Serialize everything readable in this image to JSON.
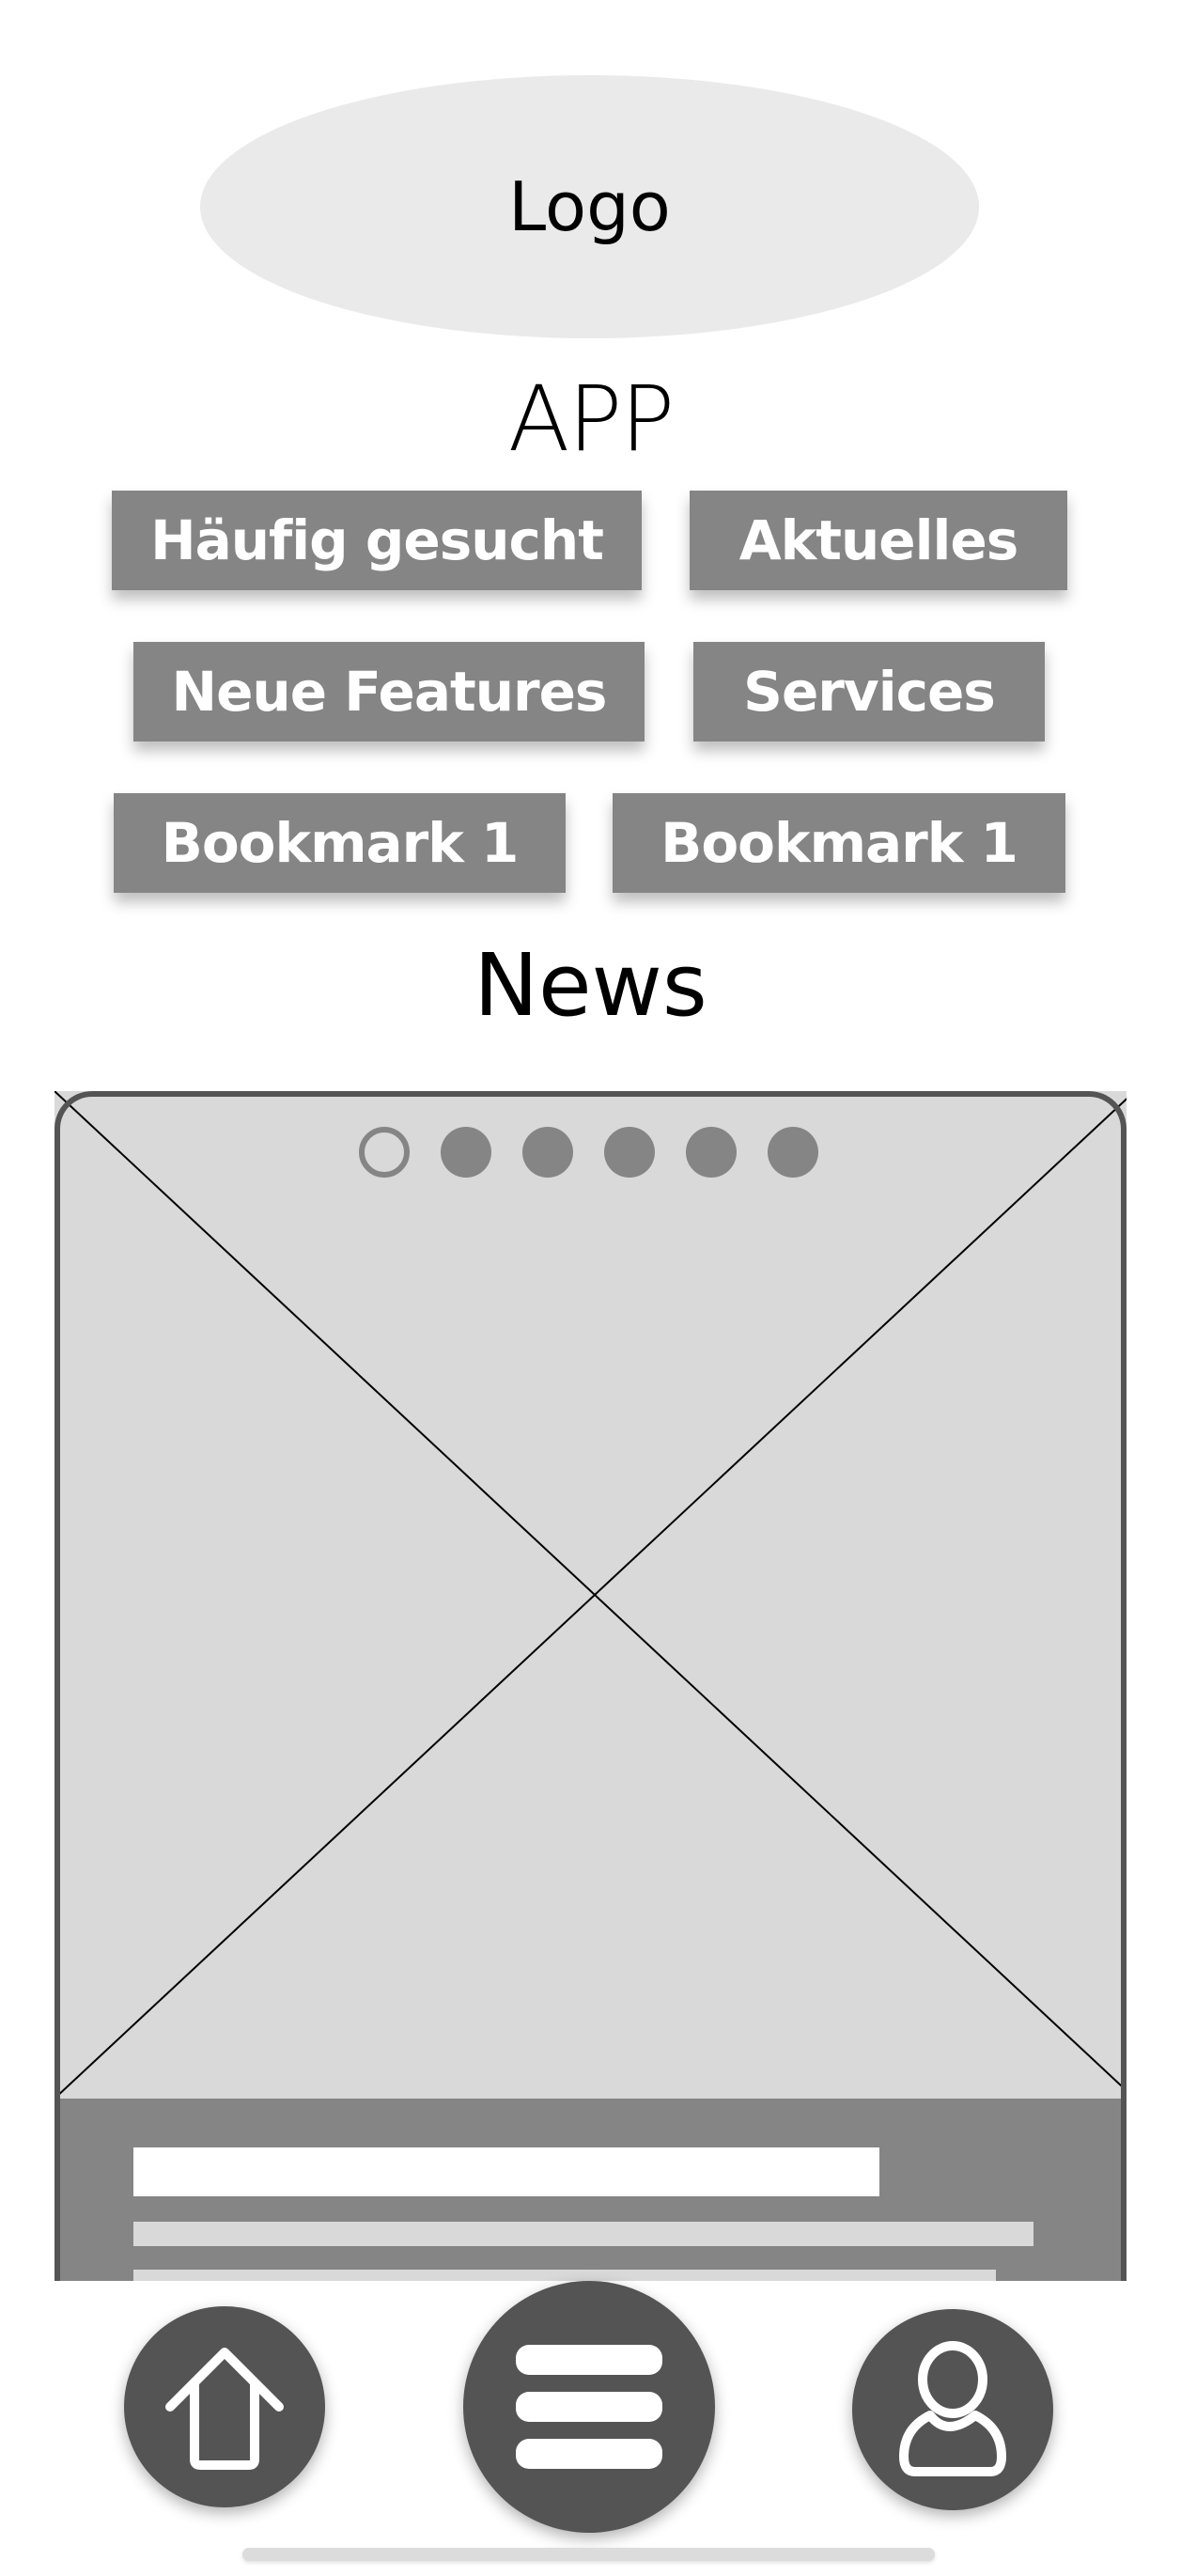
{
  "header": {
    "logo_label": "Logo",
    "app_title": "APP"
  },
  "quick_links": [
    {
      "label": "Häufig gesucht"
    },
    {
      "label": "Aktuelles"
    },
    {
      "label": "Neue Features"
    },
    {
      "label": "Services"
    },
    {
      "label": "Bookmark 1"
    },
    {
      "label": "Bookmark 1"
    }
  ],
  "news": {
    "title": "News",
    "carousel": {
      "slide_count": 6,
      "active_index": 0,
      "image_icon": "image-placeholder-icon"
    }
  },
  "bottom_nav": [
    {
      "name": "home",
      "icon": "home-icon"
    },
    {
      "name": "menu",
      "icon": "menu-icon"
    },
    {
      "name": "profile",
      "icon": "user-icon"
    }
  ],
  "colors": {
    "button_gray": "#858585",
    "dark_gray": "#545454",
    "light_gray": "#d9d9d9",
    "logo_bg": "#eaeaea"
  }
}
